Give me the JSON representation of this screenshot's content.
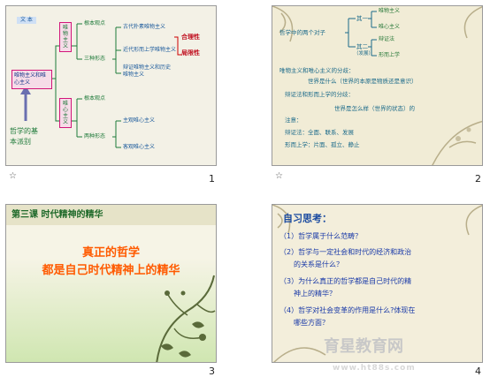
{
  "slides": [
    {
      "number": "1",
      "star": "☆",
      "top_label": "文 本",
      "left_box": "唯物主义和唯心主义",
      "left_bottom_1": "哲学的基",
      "left_bottom_2": "本派别",
      "vbox_top": "唯物主义",
      "vbox_bottom": "唯心主义",
      "r_basic_1": "根本观点",
      "r_three_forms": "三种形态",
      "r_ancient": "古代朴素唯物主义",
      "r_modern": "近代形而上学唯物主义",
      "r_dialectic": "辩证唯物主义和历史唯物主义",
      "r_reasonable": "合理性",
      "r_limited": "局限性",
      "r_basic_2": "根本观点",
      "r_two_forms": "两种形态",
      "r_subjective": "主观唯心主义",
      "r_objective": "客观唯心主义"
    },
    {
      "number": "2",
      "star": "☆",
      "center": "哲学中的两个对子",
      "line_one": "其一",
      "materialism": "唯物主义",
      "idealism": "唯心主义",
      "line_two": "其二",
      "line_two_note": "（发展）",
      "dialectics": "辩证法",
      "metaphysics": "形而上学",
      "p1": "唯物主义和唯心主义的分歧：",
      "p2": "世界是什么（世界的本原是物质还是意识）",
      "p3": "辩证法和形而上学的分歧：",
      "p4": "世界是怎么样（世界的状态）的",
      "p5": "注意：",
      "p6": "辩证法：全面、联系、发展",
      "p7": "形而上学：片面、孤立、静止"
    },
    {
      "number": "3",
      "title": "第三课 时代精神的精华",
      "line1": "真正的哲学",
      "line2": "都是自己时代精神上的精华"
    },
    {
      "number": "4",
      "heading": "自习思考：",
      "q1": "（1）哲学属于什么范畴？",
      "q2a": "（2）哲学与一定社会和时代的经济和政治",
      "q2b": "的关系是什么？",
      "q3a": "（3）为什么真正的哲学都是自己时代的精",
      "q3b": "神上的精华？",
      "q4a": "（4）哲学对社会变革的作用是什么?体现在",
      "q4b": "哪些方面？",
      "watermark": "育星教育网",
      "watermark_url": "www.ht88s.com"
    }
  ],
  "colors": {
    "accent_green": "#1e7a3a",
    "accent_orange": "#ff5a00",
    "accent_blue": "#1a3aa8",
    "border_magenta": "#d2167a"
  }
}
